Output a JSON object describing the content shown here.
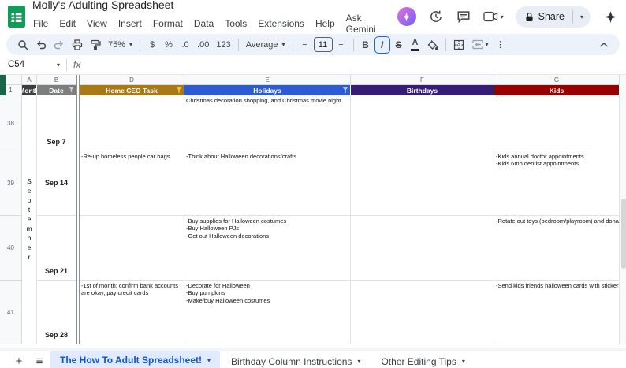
{
  "colors": {
    "month_header": "#3d3d3d",
    "date_header": "#7d7d7d",
    "home_ceo_header": "#a87914",
    "holidays_header": "#2e5bd3",
    "birthdays_header": "#351c75",
    "kids_header": "#990000",
    "active_tab_blue": "#0b57d0",
    "toolbar_bg": "#edf2fa",
    "logo_green": "#0f9d58",
    "left_edge_accent": "#176648",
    "funnel_yellow": "#f1c232",
    "funnel_blue": "#a4c2f4"
  },
  "app": {
    "title": "Molly's Adulting Spreadsheet",
    "menus": [
      "File",
      "Edit",
      "View",
      "Insert",
      "Format",
      "Data",
      "Tools",
      "Extensions",
      "Help",
      "Ask Gemini"
    ],
    "share": {
      "label": "Share"
    }
  },
  "toolbar": {
    "zoom": "75%",
    "currency": "$",
    "percent": "%",
    "decrease_decimal": ".0",
    "increase_decimal": ".00",
    "more_formats": "123",
    "style_name": "Average",
    "minus": "−",
    "font_size": "11",
    "plus": "+",
    "bold": "B",
    "italic": "I",
    "strikethrough": "S",
    "text_color": "A",
    "more": "⋮"
  },
  "formula_bar": {
    "name_box": "C54",
    "fx_label": "fx"
  },
  "grid": {
    "column_letters": [
      "A",
      "B",
      "D",
      "E",
      "F",
      "G"
    ],
    "row_numbers": [
      "1",
      "38",
      "39",
      "40",
      "41"
    ],
    "headers": {
      "month": "Month",
      "date": "Date",
      "home_ceo": "Home CEO Task",
      "holidays": "Holidays",
      "birthdays": "Birthdays",
      "kids": "Kids"
    },
    "month_label": "September",
    "rows": [
      {
        "date": "Sep 7",
        "home_ceo": "",
        "holidays": "Christmas decoration shopping, and Christmas movie night",
        "birthdays": "",
        "kids": ""
      },
      {
        "date": "Sep 14",
        "home_ceo": "-Re-up homeless people car bags",
        "holidays": "-Think about Halloween decorations/crafts",
        "birthdays": "",
        "kids": "-Kids annual doctor appointments\n-Kids 6mo dentist appointments"
      },
      {
        "date": "Sep 21",
        "home_ceo": "",
        "holidays": "-Buy supplies for Halloween costumes\n-Buy Halloween PJs\n-Get out Halloween decorations",
        "birthdays": "",
        "kids": "-Rotate out toys (bedroom/playroom) and dona"
      },
      {
        "date": "Sep 28",
        "home_ceo": "-1st of month: confirm bank accounts are okay, pay credit cards",
        "holidays": "-Decorate for Halloween\n-Buy pumpkins\n-Make/buy Halloween costumes",
        "birthdays": "",
        "kids": "-Send kids friends halloween cards with stickers"
      }
    ]
  },
  "sheet_tabs": {
    "tabs": [
      "The How To Adult Spreadsheet!",
      "Birthday Column Instructions",
      "Other Editing Tips"
    ]
  }
}
